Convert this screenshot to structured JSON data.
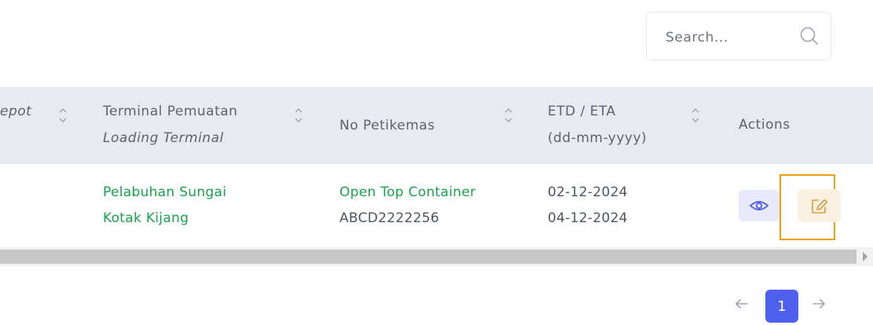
{
  "search": {
    "placeholder": "Search..."
  },
  "table": {
    "headers": {
      "depot_partial": "epot",
      "terminal_line1": "Terminal Pemuatan",
      "terminal_line2": "Loading Terminal",
      "container": "No Petikemas",
      "etd_line1": "ETD / ETA",
      "etd_line2": "(dd-mm-yyyy)",
      "actions": "Actions"
    },
    "rows": [
      {
        "terminal_line1": "Pelabuhan Sungai",
        "terminal_line2": "Kotak Kijang",
        "container_type": "Open Top Container",
        "container_no": "ABCD2222256",
        "etd": "02-12-2024",
        "eta": "04-12-2024"
      }
    ]
  },
  "actions": {
    "view_icon": "eye-icon",
    "edit_icon": "edit-icon"
  },
  "pagination": {
    "current_page": "1",
    "prev_icon": "arrow-left-icon",
    "next_icon": "arrow-right-icon"
  },
  "colors": {
    "accent": "#4f60ee",
    "green_text": "#16a34a",
    "highlight": "#f59e0b"
  }
}
